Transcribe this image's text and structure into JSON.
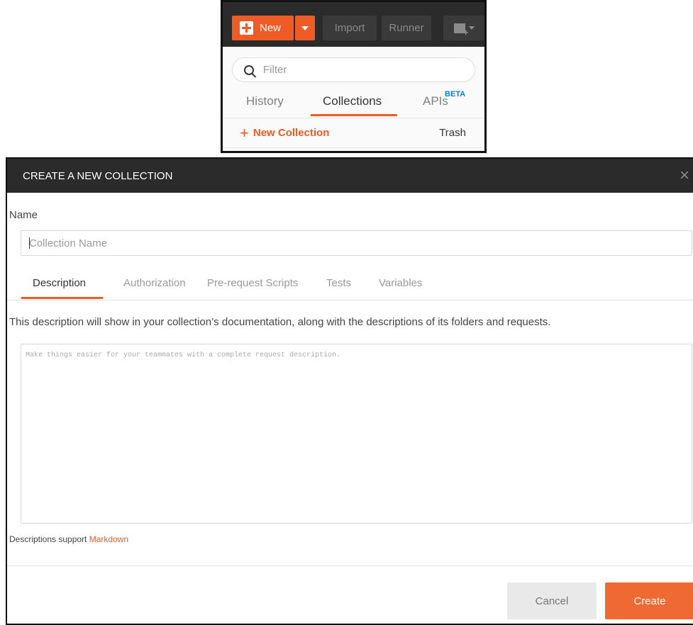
{
  "toolbar": {
    "new_label": "New",
    "import_label": "Import",
    "runner_label": "Runner",
    "icons": [
      "plus-icon",
      "caret-down-icon",
      "new-window-icon"
    ]
  },
  "sidebar": {
    "filter_placeholder": "Filter",
    "tabs": [
      {
        "label": "History",
        "active": false
      },
      {
        "label": "Collections",
        "active": true
      },
      {
        "label": "APIs",
        "badge": "BETA",
        "active": false
      }
    ],
    "new_collection_label": "New Collection",
    "trash_label": "Trash"
  },
  "modal": {
    "title": "CREATE A NEW COLLECTION",
    "close_glyph": "×",
    "name_label": "Name",
    "name_placeholder": "Collection Name",
    "name_value": "",
    "tabs": [
      {
        "label": "Description",
        "active": true
      },
      {
        "label": "Authorization",
        "active": false
      },
      {
        "label": "Pre-request Scripts",
        "active": false
      },
      {
        "label": "Tests",
        "active": false
      },
      {
        "label": "Variables",
        "active": false
      }
    ],
    "description_info": "This description will show in your collection’s documentation, along with the descriptions of its folders and requests.",
    "description_placeholder": "Make things easier for your teammates with a complete request description.",
    "markdown_note": "Descriptions support",
    "markdown_link": "Markdown",
    "cancel_label": "Cancel",
    "create_label": "Create"
  },
  "colors": {
    "accent": "#ef5b25",
    "header_dark": "#2b2b2b",
    "beta": "#0c7cd5"
  }
}
